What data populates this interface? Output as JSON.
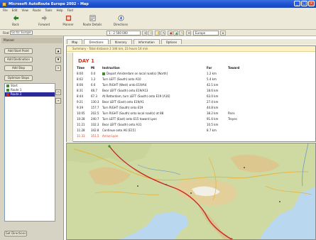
{
  "window": {
    "title": "Microsoft AutoRoute Europe 2002 - Map",
    "controls": [
      "_",
      "□",
      "×"
    ]
  },
  "menu": [
    "File",
    "Edit",
    "View",
    "Route",
    "Tools",
    "Help",
    "Find"
  ],
  "toolbar": {
    "buttons": [
      {
        "label": "Back",
        "icon": "back-arrow-icon"
      },
      {
        "label": "Forward",
        "icon": "forward-arrow-icon"
      },
      {
        "label": "Planner",
        "icon": "route-planner-icon"
      },
      {
        "label": "Route Details",
        "icon": "route-details-icon"
      },
      {
        "label": "Directions",
        "icon": "directions-icon"
      }
    ]
  },
  "address_bar": {
    "label": "Find",
    "value": "Go to: Europe"
  },
  "find_toolbar": {
    "zoom_value": "1 : 2 500 000",
    "search_value": "Europe"
  },
  "sidebar": {
    "header": "Planner",
    "buttons": [
      "Add Start Point",
      "Add Destination",
      "Add Stop",
      "Optimize Stops"
    ],
    "route_items": [
      {
        "label": "Start",
        "color": "#3e8d2e",
        "selected": false
      },
      {
        "label": "Route 1",
        "color": "#3e8d2e",
        "selected": false
      },
      {
        "label": "Route 2",
        "color": "#c8282a",
        "selected": true
      }
    ],
    "bottom_button": "Get Directions"
  },
  "tabs": [
    "Map",
    "Directions",
    "Itinerary",
    "Information",
    "Options"
  ],
  "itinerary": {
    "header": "Summary - Total distance 2 344 km, 23 hours 14 min",
    "day_title": "DAY 1",
    "columns": [
      "Time",
      "Mi",
      "Instruction",
      "For",
      "Toward"
    ],
    "rows": [
      {
        "time": "8:00",
        "mi": "0.0",
        "text": "Depart Amsterdam on local road(s) [North]",
        "dist": "1.2 km",
        "note": "",
        "start": true
      },
      {
        "time": "8:02",
        "mi": "1.2",
        "text": "Turn LEFT (South) onto A10",
        "dist": "5.4 km",
        "note": ""
      },
      {
        "time": "8:06",
        "mi": "6.6",
        "text": "Turn RIGHT (West) onto E19/A4",
        "dist": "42.1 km",
        "note": ""
      },
      {
        "time": "8:31",
        "mi": "48.7",
        "text": "Bear LEFT (South) onto E19/A13",
        "dist": "18.6 km",
        "note": ""
      },
      {
        "time": "8:44",
        "mi": "67.3",
        "text": "At Rotterdam, turn LEFT (South) onto E19 [A16]",
        "dist": "63.0 km",
        "note": ""
      },
      {
        "time": "9:21",
        "mi": "130.3",
        "text": "Bear LEFT (East) onto E19/A1",
        "dist": "27.4 km",
        "note": ""
      },
      {
        "time": "9:39",
        "mi": "157.7",
        "text": "Turn RIGHT (South) onto E19",
        "dist": "44.8 km",
        "note": ""
      },
      {
        "time": "10:05",
        "mi": "202.5",
        "text": "Turn RIGHT (South) onto local road(s) at 88",
        "dist": "38.2 km",
        "note": "Paris"
      },
      {
        "time": "10:28",
        "mi": "240.7",
        "text": "Turn LEFT (East) onto E15 toward Lyon",
        "dist": "91.6 km",
        "note": "Troyes"
      },
      {
        "time": "11:21",
        "mi": "332.3",
        "text": "Bear LEFT (South) onto A31",
        "dist": "10.5 km",
        "note": ""
      },
      {
        "time": "11:28",
        "mi": "342.8",
        "text": "Continue onto A6 [E15]",
        "dist": "8.7 km",
        "note": ""
      },
      {
        "time": "11:33",
        "mi": "351.5",
        "text": "Arrive Lyon",
        "dist": "",
        "note": "",
        "red": true
      }
    ]
  },
  "map": {
    "region": "Europe",
    "route_color": "#c8282a"
  }
}
